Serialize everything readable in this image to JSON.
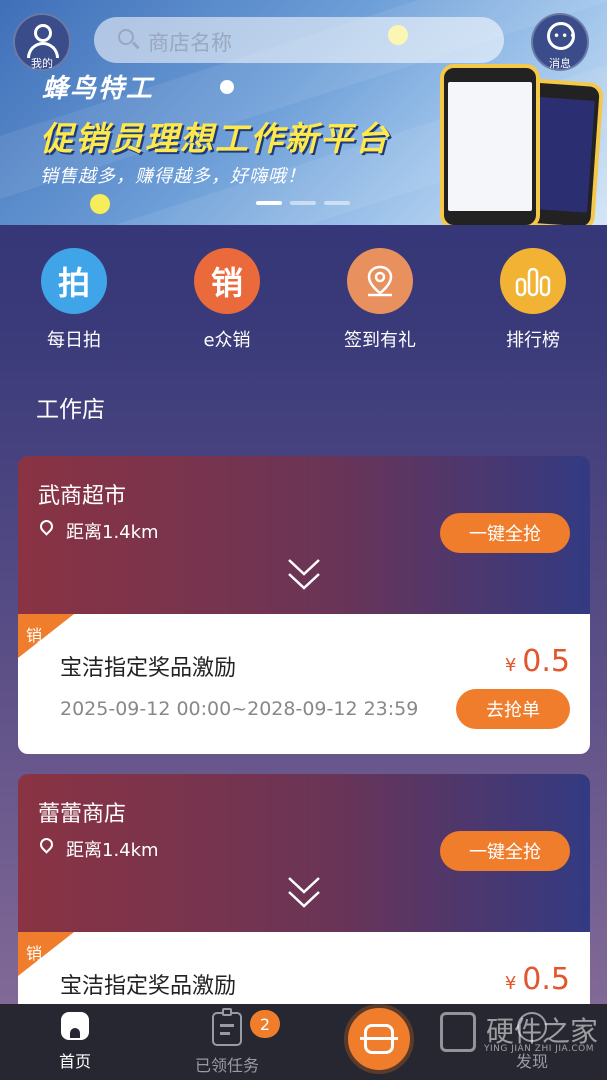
{
  "header": {
    "profile_label": "我的",
    "search_placeholder": "商店名称",
    "message_label": "消息"
  },
  "banner": {
    "brand": "蜂鸟特工",
    "slogan": "促销员理想工作新平台",
    "subline": "销售越多，赚得越多，好嗨哦！",
    "slide_count": 3,
    "active_slide": 1
  },
  "quick_actions": [
    {
      "label": "每日拍",
      "glyph": "拍",
      "color": "#3fa5e8",
      "icon": "camera-badge-icon"
    },
    {
      "label": "e众销",
      "glyph": "销",
      "color": "#ea6a3c",
      "icon": "sales-badge-icon"
    },
    {
      "label": "签到有礼",
      "glyph": "",
      "color": "#e8915e",
      "icon": "location-pin-icon"
    },
    {
      "label": "排行榜",
      "glyph": "",
      "color": "#f2b233",
      "icon": "bar-chart-icon"
    }
  ],
  "section": {
    "title": "工作店"
  },
  "stores": [
    {
      "name": "武商超市",
      "distance": "距离1.4km",
      "grab_all_label": "一键全抢",
      "task": {
        "tag": "销",
        "title": "宝洁指定奖品激励",
        "currency": "¥",
        "amount": "0.5",
        "period": "2025-09-12 00:00~2028-09-12 23:59",
        "grab_label": "去抢单"
      }
    },
    {
      "name": "蕾蕾商店",
      "distance": "距离1.4km",
      "grab_all_label": "一键全抢",
      "task": {
        "tag": "销",
        "title": "宝洁指定奖品激励",
        "currency": "¥",
        "amount": "0.5"
      }
    }
  ],
  "nav": {
    "home_label": "首页",
    "tasks_label": "已领任务",
    "tasks_badge": "2",
    "discover_label": "发现"
  },
  "watermark": {
    "title": "硬件之家",
    "url": "YING JIAN ZHI JIA.COM"
  },
  "colors": {
    "accent": "#ef7d2c",
    "price": "#e2562c",
    "slogan": "#ffe94a"
  }
}
